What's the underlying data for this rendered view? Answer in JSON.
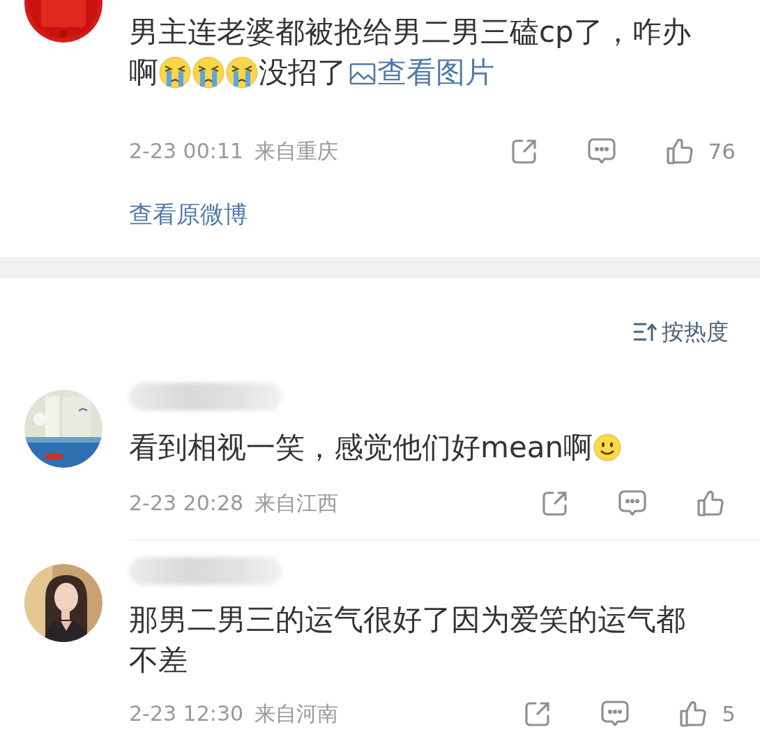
{
  "post": {
    "segments": [
      {
        "kind": "text",
        "text": "男主连老婆都被抢给男二男三磕cp了，咋办啊"
      },
      {
        "kind": "crying"
      },
      {
        "kind": "crying"
      },
      {
        "kind": "crying"
      },
      {
        "kind": "text",
        "text": "没招了"
      },
      {
        "kind": "link",
        "text": "查看图片"
      }
    ],
    "time": "2-23 00:11",
    "location": "来自重庆",
    "likes": "76",
    "view_original": "查看原微博"
  },
  "sort": "按热度",
  "comments": [
    {
      "segments": [
        {
          "kind": "text",
          "text": "看到相视一笑，感觉他们好mean啊"
        },
        {
          "kind": "smiling"
        }
      ],
      "time": "2-23 20:28",
      "location": "来自江西"
    },
    {
      "segments": [
        {
          "kind": "text",
          "text": "那男二男三的运气很好了因为爱笑的运气都不差"
        }
      ],
      "time": "2-23 12:30",
      "location": "来自河南",
      "likes": "5"
    }
  ]
}
